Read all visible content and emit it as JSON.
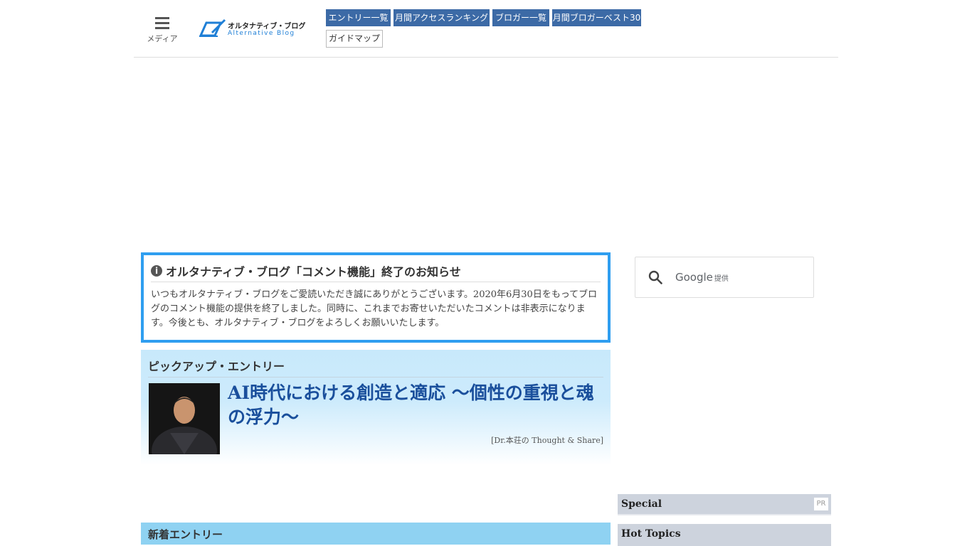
{
  "header": {
    "menu_label": "メディア",
    "logo_jp": "オルタナティブ・ブログ",
    "logo_en": "Alternative Blog",
    "nav": [
      "エントリー一覧",
      "月間アクセスランキング",
      "ブロガー一覧",
      "月間ブロガーベスト30"
    ],
    "guide_map": "ガイドマップ"
  },
  "notice": {
    "title": "オルタナティブ・ブログ「コメント機能」終了のお知らせ",
    "body": "いつもオルタナティブ・ブログをご愛読いただき誠にありがとうございます。2020年6月30日をもってブログのコメント機能の提供を終了しました。同時に、これまでお寄せいただいたコメントは非表示になります。今後とも、オルタナティブ・ブログをよろしくお願いいたします。"
  },
  "pickup": {
    "heading": "ピックアップ・エントリー",
    "title": "AI時代における創造と適応 ～個性の重視と魂の浮力～",
    "source": "[Dr.本荘の Thought & Share]"
  },
  "search": {
    "brand": "Google",
    "suffix": "提供"
  },
  "sidebar": {
    "special": "Special",
    "pr": "PR",
    "hot_topics": "Hot Topics"
  },
  "main": {
    "new_entries": "新着エントリー"
  },
  "colors": {
    "nav": "#3c6aa6",
    "notice_border": "#2f9ef0",
    "pickup_title": "#1a4f9c",
    "new_bar": "#8fd2f2",
    "sidebar_bar": "#cdd3dd"
  }
}
